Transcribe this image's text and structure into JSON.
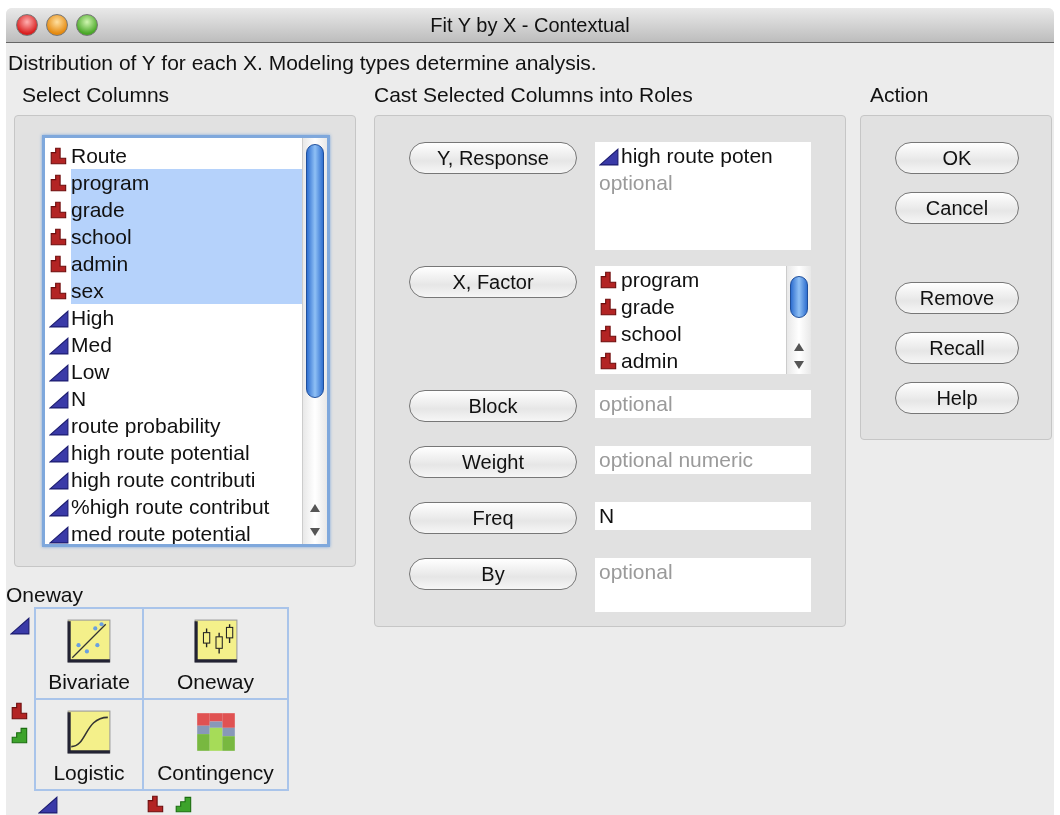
{
  "window": {
    "title": "Fit Y by X - Contextual"
  },
  "description": "Distribution of Y for each X. Modeling types determine analysis.",
  "select_columns": {
    "title": "Select Columns",
    "items": [
      {
        "label": "Route",
        "kind": "nominal",
        "selected": false
      },
      {
        "label": "program",
        "kind": "nominal",
        "selected": true
      },
      {
        "label": "grade",
        "kind": "nominal",
        "selected": true
      },
      {
        "label": "school",
        "kind": "nominal",
        "selected": true
      },
      {
        "label": "admin",
        "kind": "nominal",
        "selected": true
      },
      {
        "label": "sex",
        "kind": "nominal",
        "selected": true
      },
      {
        "label": "High",
        "kind": "continuous",
        "selected": false
      },
      {
        "label": "Med",
        "kind": "continuous",
        "selected": false
      },
      {
        "label": "Low",
        "kind": "continuous",
        "selected": false
      },
      {
        "label": "N",
        "kind": "continuous",
        "selected": false
      },
      {
        "label": "route probability",
        "kind": "continuous",
        "selected": false
      },
      {
        "label": "high route potential",
        "kind": "continuous",
        "selected": false
      },
      {
        "label": "high route contributi",
        "kind": "continuous",
        "selected": false
      },
      {
        "label": "%high route contribut",
        "kind": "continuous",
        "selected": false
      },
      {
        "label": "med route potential",
        "kind": "continuous",
        "selected": false
      }
    ]
  },
  "roles": {
    "title": "Cast Selected Columns into Roles",
    "rows": [
      {
        "button": "Y, Response",
        "kind": "list",
        "items": [
          {
            "label": "high route poten",
            "kind": "continuous"
          }
        ],
        "placeholder": "optional"
      },
      {
        "button": "X, Factor",
        "kind": "scroll-list",
        "items": [
          {
            "label": "program",
            "kind": "nominal"
          },
          {
            "label": "grade",
            "kind": "nominal"
          },
          {
            "label": "school",
            "kind": "nominal"
          },
          {
            "label": "admin",
            "kind": "nominal"
          }
        ]
      },
      {
        "button": "Block",
        "kind": "field",
        "placeholder": "optional"
      },
      {
        "button": "Weight",
        "kind": "field",
        "placeholder": "optional numeric"
      },
      {
        "button": "Freq",
        "kind": "field",
        "value": "N"
      },
      {
        "button": "By",
        "kind": "tall-field",
        "placeholder": "optional"
      }
    ]
  },
  "action": {
    "title": "Action",
    "groups": [
      {
        "buttons": [
          "OK",
          "Cancel"
        ]
      },
      {
        "buttons": [
          "Remove",
          "Recall",
          "Help"
        ]
      }
    ]
  },
  "platforms": {
    "title": "Oneway",
    "row_types": [
      [
        {
          "kind": "continuous"
        }
      ],
      [
        {
          "kind": "nominal"
        },
        {
          "kind": "ordinal"
        }
      ]
    ],
    "column_types": [
      [
        {
          "kind": "continuous"
        }
      ],
      [
        {
          "kind": "nominal"
        },
        {
          "kind": "ordinal"
        }
      ]
    ],
    "cells": [
      {
        "label": "Bivariate",
        "kind": "bivariate"
      },
      {
        "label": "Oneway",
        "kind": "oneway"
      },
      {
        "label": "Logistic",
        "kind": "logistic"
      },
      {
        "label": "Contingency",
        "kind": "contingency"
      }
    ]
  }
}
